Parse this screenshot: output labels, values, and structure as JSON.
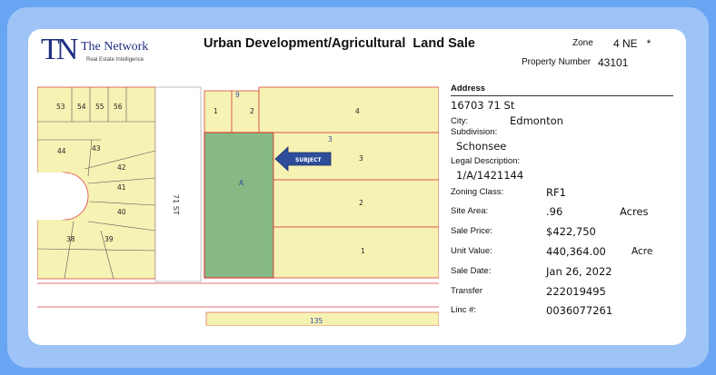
{
  "brand": {
    "initials": "TN",
    "name": "The Network",
    "tagline": "Real Estate Intelligence"
  },
  "title": "Urban Development/Agricultural  Land Sale",
  "zone": {
    "label": "Zone",
    "value": "4 NE   *"
  },
  "property_number": {
    "label": "Property Number",
    "value": "43101"
  },
  "map": {
    "subject_label": "SUBJECT",
    "parcel_label": "A",
    "street_label": "71 ST",
    "lots_left": [
      "53",
      "54",
      "55",
      "56",
      "44",
      "43",
      "42",
      "41",
      "40",
      "38",
      "39"
    ],
    "lots_right": [
      "1",
      "2",
      "4",
      "3",
      "2",
      "1"
    ],
    "lot_top_small": "9",
    "lot_mid_small": "3",
    "bottom_label": "135"
  },
  "details": {
    "address_heading": "Address",
    "address": "16703 71 St",
    "city_label": "City:",
    "city": "Edmonton",
    "subdivision_label": "Subdivision:",
    "subdivision": "Schonsee",
    "legal_label": "Legal Description:",
    "legal": "1/A/1421144",
    "zoning_label": "Zoning Class:",
    "zoning": "RF1",
    "site_area_label": "Site Area:",
    "site_area": ".96",
    "site_area_unit": "Acres",
    "sale_price_label": "Sale Price:",
    "sale_price": "$422,750",
    "unit_value_label": "Unit Value:",
    "unit_value": "440,364.00",
    "unit_value_unit": "Acre",
    "sale_date_label": "Sale Date:",
    "sale_date": "Jan 26, 2022",
    "transfer_label": "Transfer",
    "transfer": "222019495",
    "linc_label": "Linc #:",
    "linc": "0036077261"
  },
  "colors": {
    "background": "#6aa5f3",
    "frame": "#9ec3f7",
    "lots": "#f6f2b4",
    "subject": "#86b984",
    "lot_lines": "#d9423d",
    "brand": "#1f2e80"
  }
}
